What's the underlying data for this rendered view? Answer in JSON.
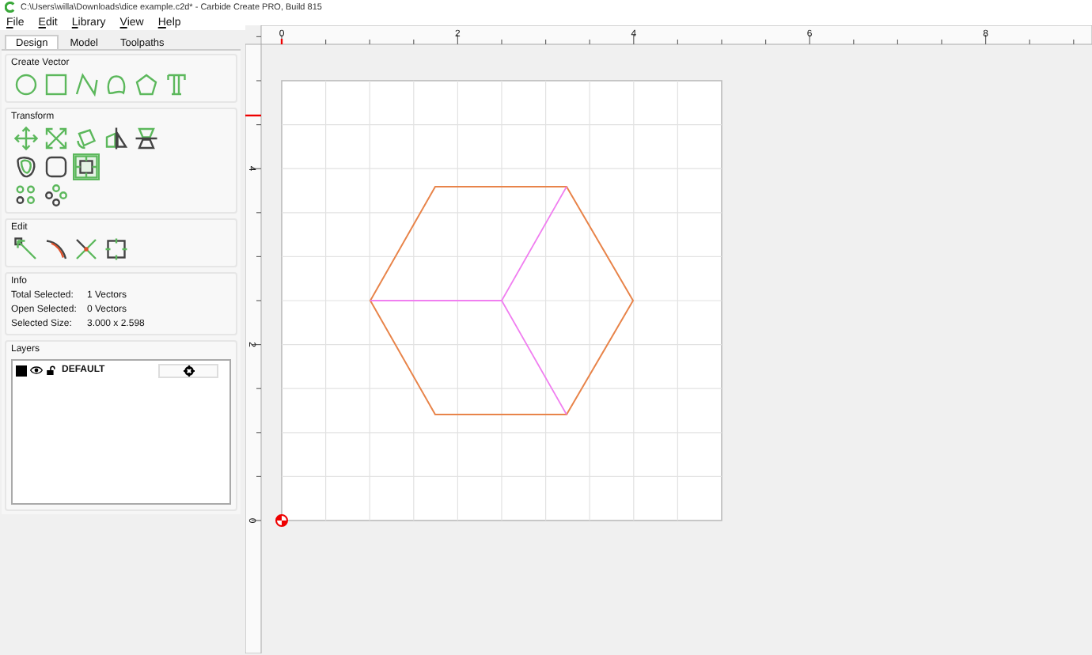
{
  "window": {
    "title": "C:\\Users\\willa\\Downloads\\dice example.c2d* - Carbide Create PRO, Build 815"
  },
  "menu": [
    "File",
    "Edit",
    "Library",
    "View",
    "Help"
  ],
  "tabs": [
    {
      "label": "Design",
      "selected": true
    },
    {
      "label": "Model",
      "selected": false
    },
    {
      "label": "Toolpaths",
      "selected": false
    }
  ],
  "sections": {
    "create_vector": "Create Vector",
    "transform": "Transform",
    "edit": "Edit",
    "info": "Info",
    "layers": "Layers"
  },
  "info": [
    {
      "label": "Total Selected:",
      "value": "1 Vectors"
    },
    {
      "label": "Open Selected:",
      "value": "0 Vectors"
    },
    {
      "label": "Selected Size:",
      "value": "3.000 x 2.598"
    }
  ],
  "layers": [
    {
      "name": "DEFAULT",
      "color": "#000000",
      "visible": true,
      "locked": false
    }
  ],
  "ruler": {
    "x_labels": [
      "0",
      "2",
      "4",
      "6",
      "8"
    ],
    "y_labels": [
      "4",
      "2",
      "0"
    ]
  }
}
